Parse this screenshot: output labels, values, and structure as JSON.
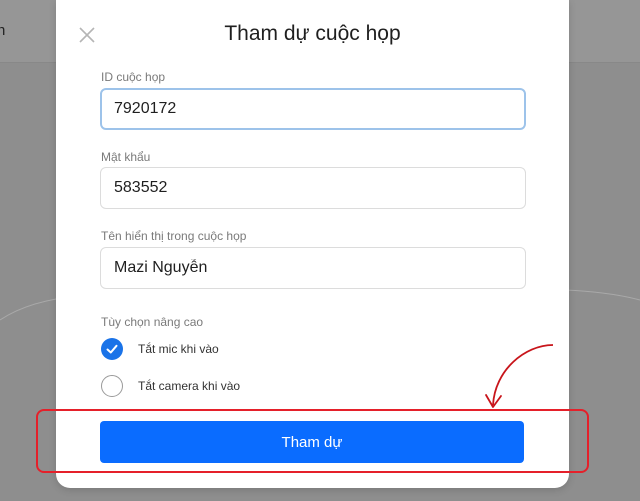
{
  "background": {
    "partial_text": "n"
  },
  "dialog": {
    "title": "Tham dự cuộc họp",
    "meeting_id": {
      "label": "ID cuộc họp",
      "value": "7920172"
    },
    "password": {
      "label": "Mật khẩu",
      "value": "583552"
    },
    "display_name": {
      "label": "Tên hiển thị trong cuộc họp",
      "value": "Mazi Nguyễn"
    },
    "advanced": {
      "label": "Tùy chọn nâng cao",
      "options": [
        {
          "label": "Tắt mic khi vào",
          "checked": true
        },
        {
          "label": "Tắt camera khi vào",
          "checked": false
        }
      ]
    },
    "join_button": "Tham dự"
  },
  "colors": {
    "primary": "#0a6cff",
    "checkbox_on": "#1a73e8",
    "annotation": "#e5202a",
    "focus_border": "#9dc3ea"
  },
  "icons": {
    "close": "close-icon",
    "check": "check-icon",
    "arrow": "curved-arrow-icon"
  }
}
